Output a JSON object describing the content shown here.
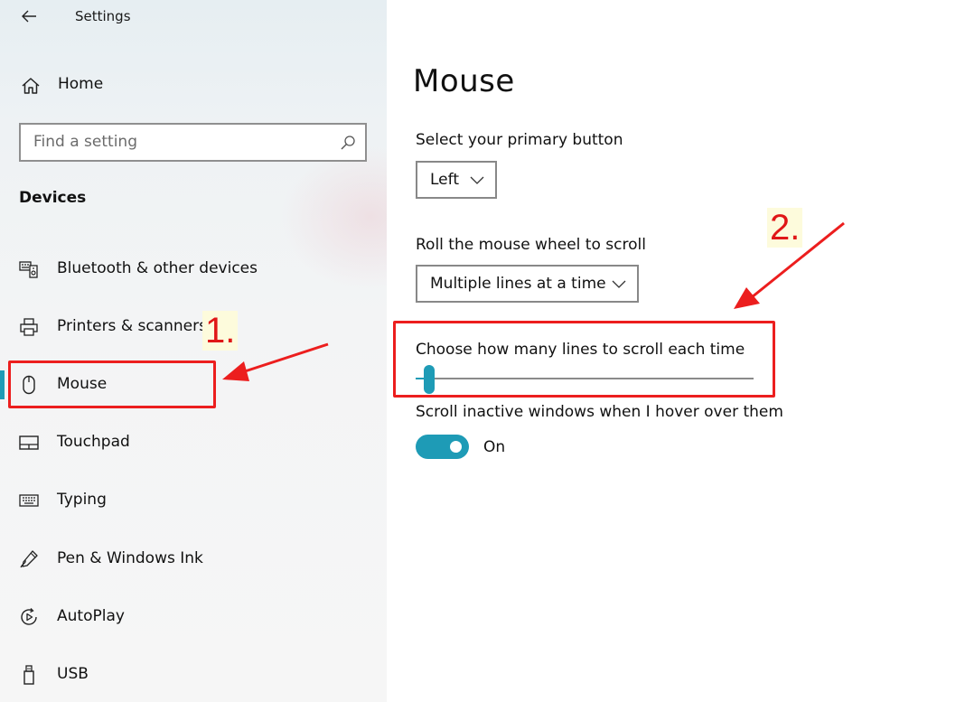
{
  "window": {
    "title": "Settings"
  },
  "sidebar": {
    "home_label": "Home",
    "search_placeholder": "Find a setting",
    "section_title": "Devices",
    "items": [
      {
        "label": "Bluetooth & other devices",
        "icon": "bluetooth-devices-icon"
      },
      {
        "label": "Printers & scanners",
        "icon": "printer-icon"
      },
      {
        "label": "Mouse",
        "icon": "mouse-icon",
        "selected": true
      },
      {
        "label": "Touchpad",
        "icon": "touchpad-icon"
      },
      {
        "label": "Typing",
        "icon": "keyboard-icon"
      },
      {
        "label": "Pen & Windows Ink",
        "icon": "pen-icon"
      },
      {
        "label": "AutoPlay",
        "icon": "autoplay-icon"
      },
      {
        "label": "USB",
        "icon": "usb-icon"
      }
    ]
  },
  "main": {
    "title": "Mouse",
    "primary_button": {
      "label": "Select your primary button",
      "value": "Left"
    },
    "wheel_scroll": {
      "label": "Roll the mouse wheel to scroll",
      "value": "Multiple lines at a time"
    },
    "lines_to_scroll": {
      "label": "Choose how many lines to scroll each time",
      "value_fraction": 0.03
    },
    "inactive_scroll": {
      "label": "Scroll inactive windows when I hover over them",
      "state": "On",
      "enabled": true
    }
  },
  "annotations": {
    "step1": "1.",
    "step2": "2.",
    "color": "#e01717"
  },
  "colors": {
    "accent": "#1e9bb6",
    "sidebar_bg": "#f3f4f5",
    "annotation_red": "#ec1e1e"
  }
}
